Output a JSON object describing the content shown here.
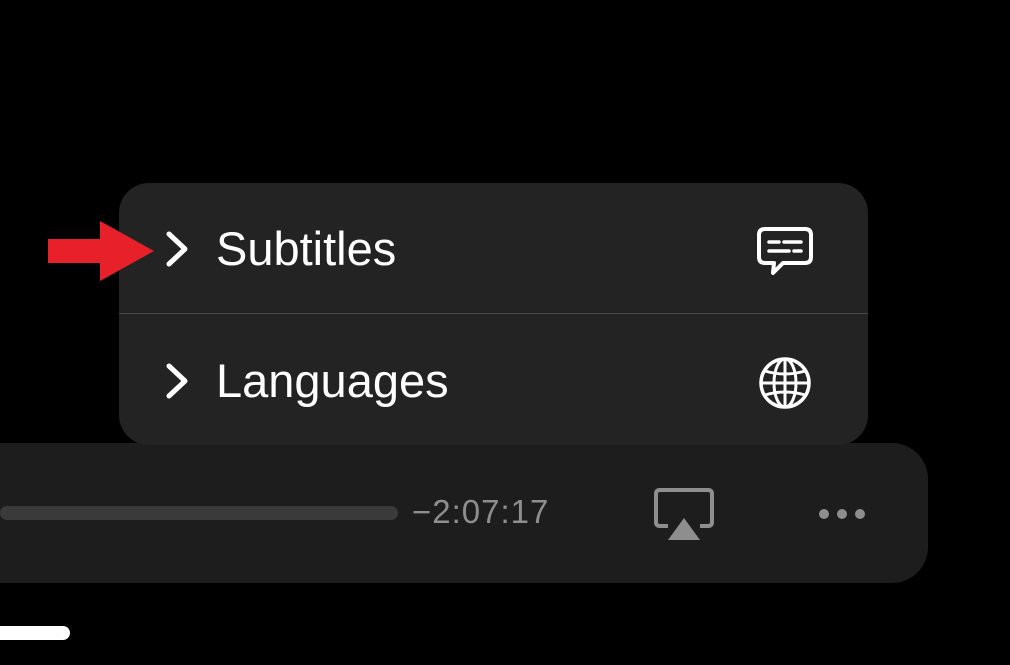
{
  "menu": {
    "items": [
      {
        "label": "Subtitles",
        "icon": "subtitles-speech-bubble-icon"
      },
      {
        "label": "Languages",
        "icon": "globe-icon"
      }
    ]
  },
  "player": {
    "time_remaining": "−2:07:17",
    "airplay_icon": "airplay-icon",
    "more_icon": "ellipsis-icon"
  },
  "annotation": {
    "pointer_icon": "red-arrow-icon",
    "pointer_color": "#e8202a"
  },
  "colors": {
    "background": "#000000",
    "menu_background": "#232323",
    "bar_background": "#1d1d1d",
    "text_primary": "#ffffff",
    "text_secondary": "#8e8e8e"
  }
}
